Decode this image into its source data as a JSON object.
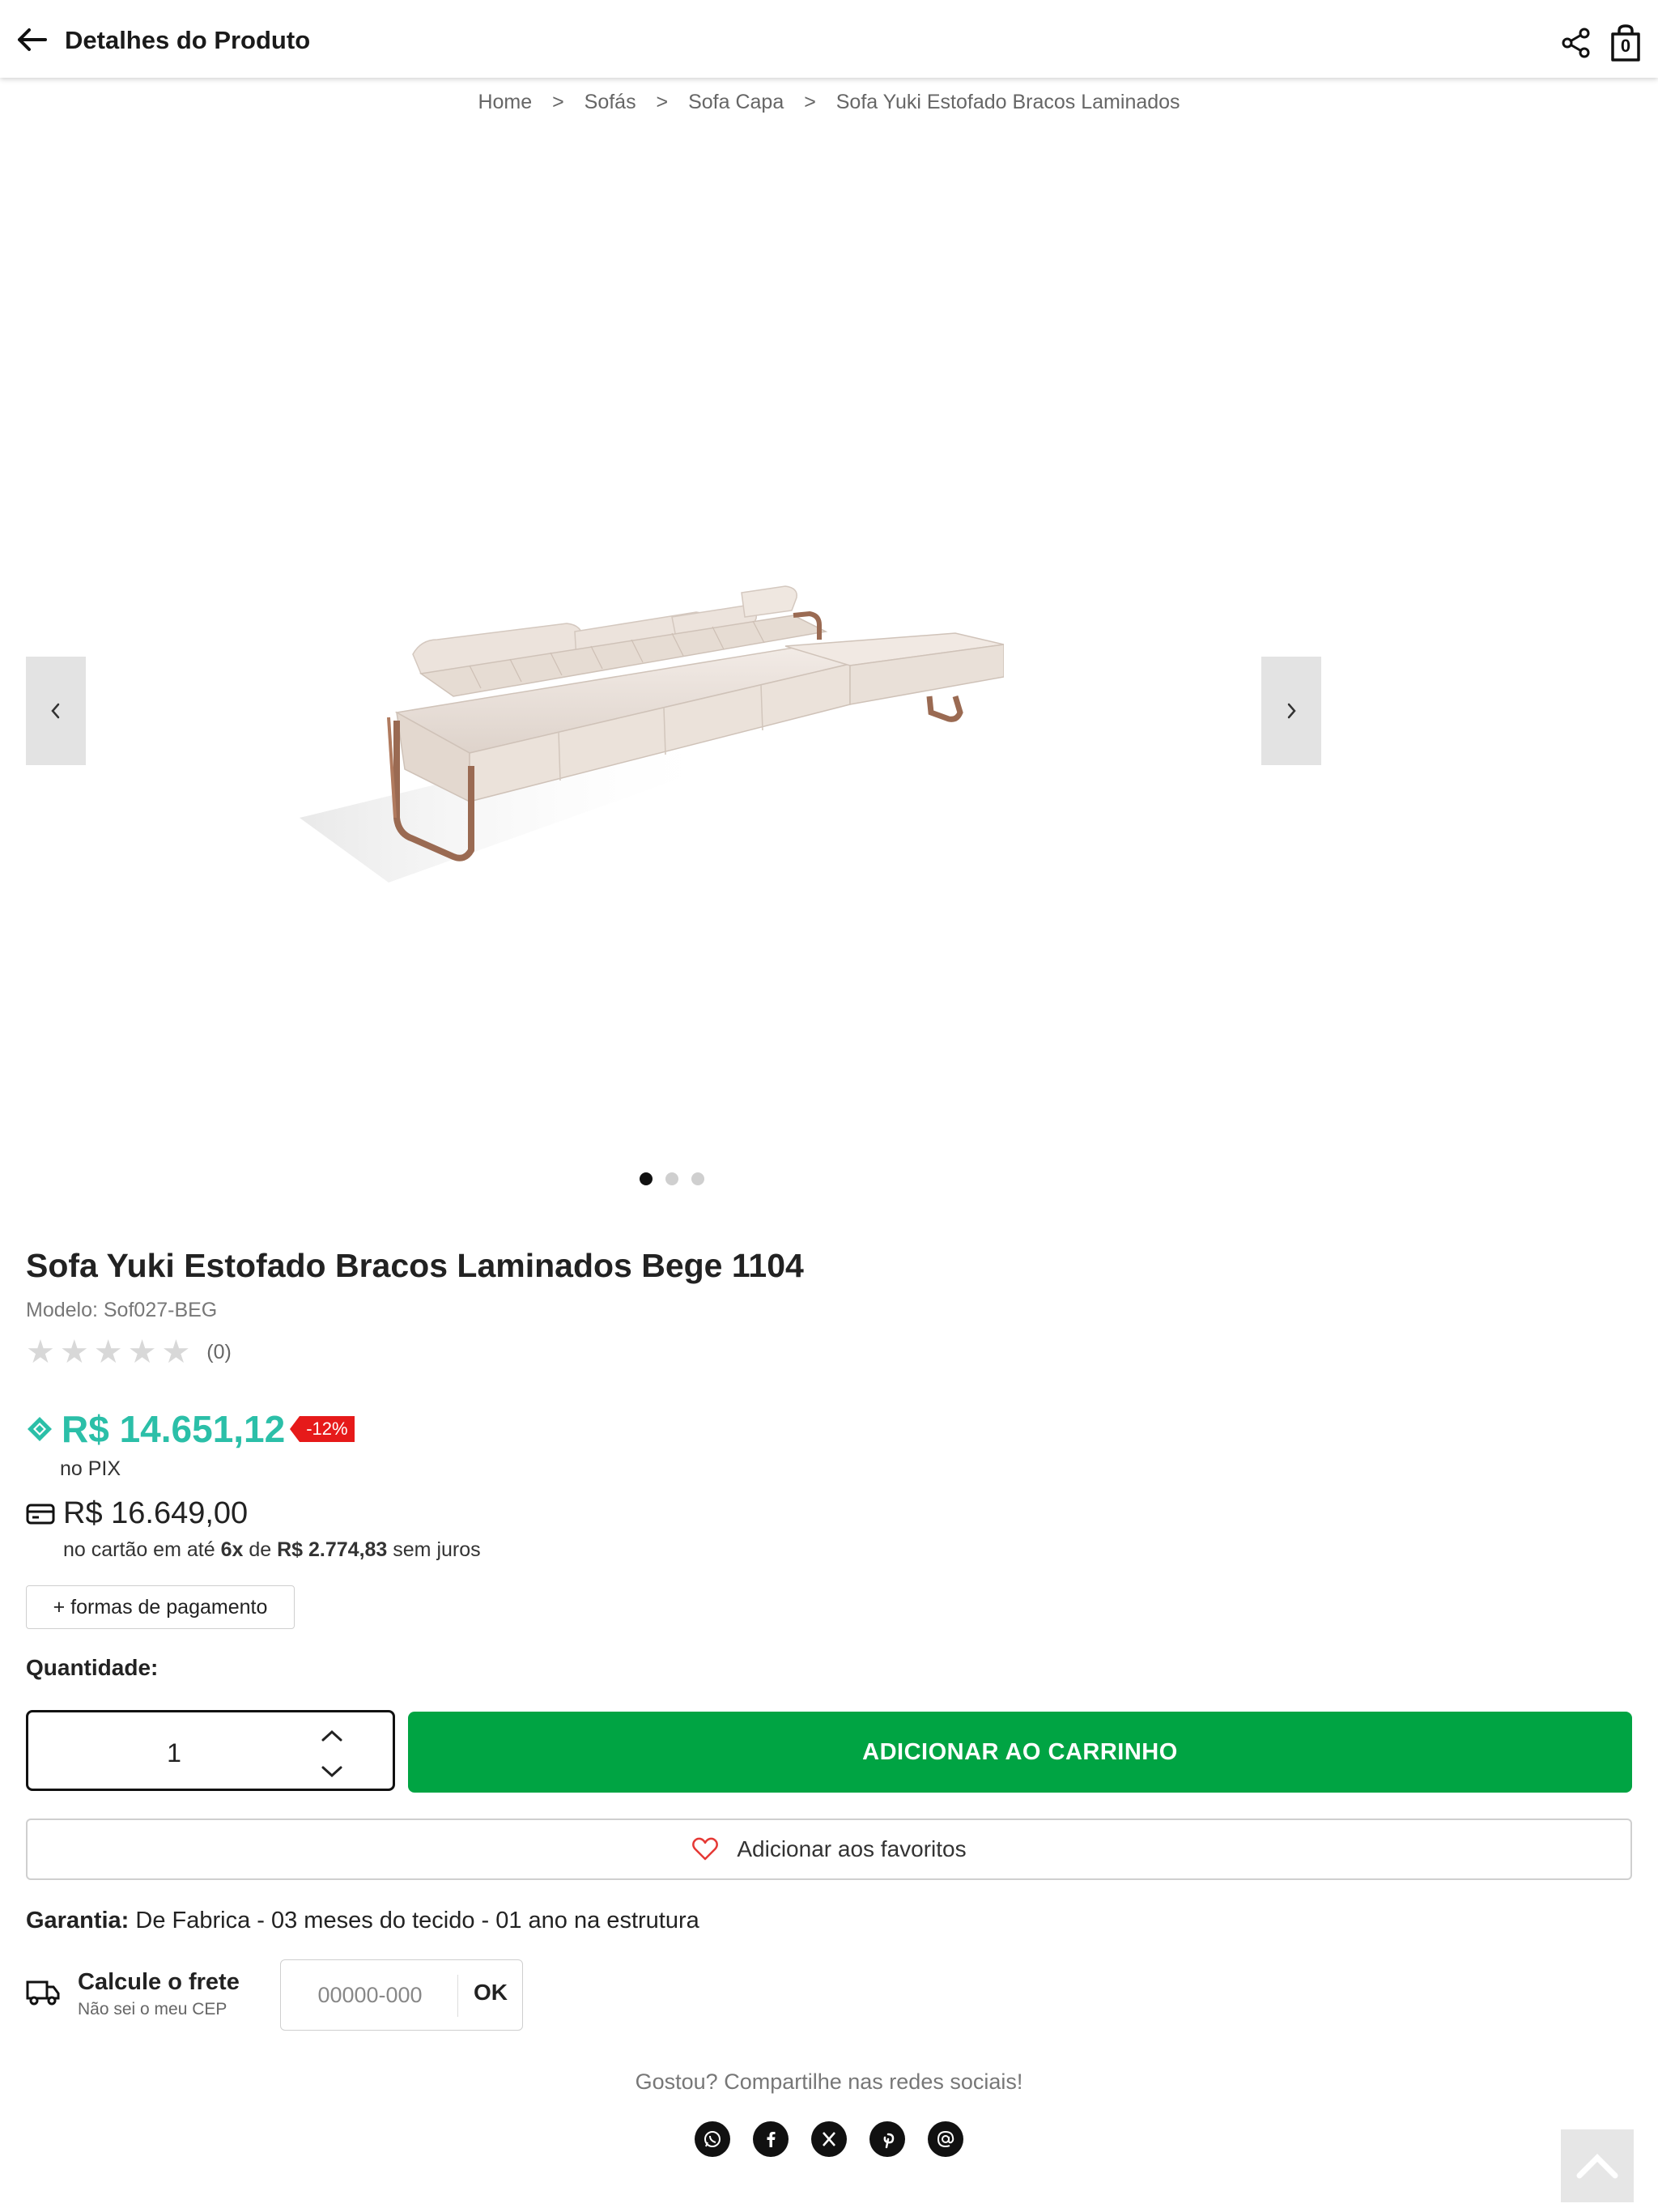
{
  "header": {
    "title": "Detalhes do Produto",
    "cart_count": "0"
  },
  "breadcrumb": {
    "items": [
      "Home",
      "Sofás",
      "Sofa Capa",
      "Sofa Yuki Estofado Bracos Laminados"
    ],
    "separator": ">"
  },
  "gallery": {
    "image_icon": "sofa-image",
    "slides": 3,
    "active_slide": 1
  },
  "product": {
    "title": "Sofa Yuki Estofado Bracos Laminados Bege 1104",
    "model": "Modelo: Sof027-BEG",
    "rating_stars": 0,
    "rating_count": "(0)"
  },
  "pricing": {
    "pix_price": "R$ 14.651,12",
    "discount_badge": "-12%",
    "pix_label": "no PIX",
    "card_price": "R$ 16.649,00",
    "installments_prefix": "no cartão em até",
    "installments_count": "6x",
    "installments_mid": "de",
    "installment_value": "R$ 2.774,83",
    "installments_suffix": "sem juros",
    "more_payment_label": "+ formas de pagamento",
    "colors": {
      "pix": "#2bbfa8",
      "discount": "#e61a1a"
    }
  },
  "purchase": {
    "quantity_label": "Quantidade:",
    "quantity_value": "1",
    "add_to_cart_label": "ADICIONAR AO CARRINHO",
    "favorites_label": "Adicionar aos favoritos",
    "colors": {
      "add_to_cart": "#00a443"
    }
  },
  "warranty": {
    "label": "Garantia:",
    "text": " De Fabrica - 03 meses do tecido - 01 ano na estrutura"
  },
  "shipping": {
    "title": "Calcule o frete",
    "help_link": "Não sei o meu CEP",
    "cep_placeholder": "00000-000",
    "ok_label": "OK"
  },
  "social": {
    "label": "Gostou? Compartilhe nas redes sociais!",
    "icons": [
      "whatsapp-icon",
      "facebook-icon",
      "x-icon",
      "pinterest-icon",
      "email-icon"
    ]
  }
}
